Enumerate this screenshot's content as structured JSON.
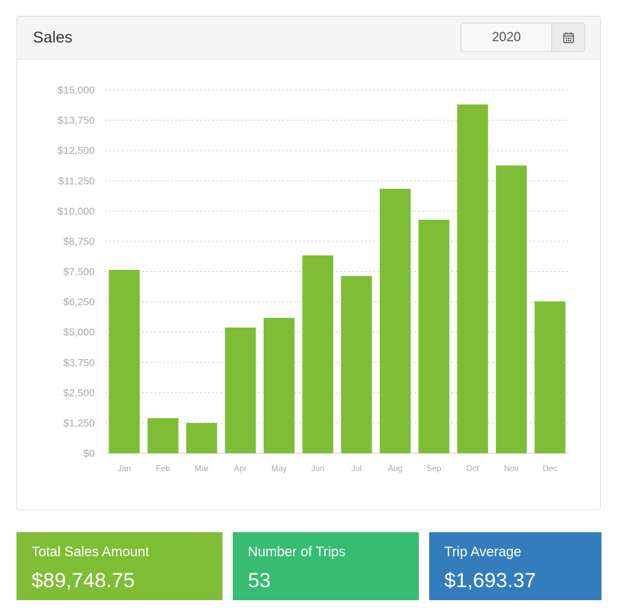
{
  "panel": {
    "title": "Sales",
    "year": "2020",
    "calendar_icon": "calendar-icon"
  },
  "chart_data": {
    "type": "bar",
    "title": "",
    "xlabel": "",
    "ylabel": "",
    "categories": [
      "Jan",
      "Feb",
      "Mar",
      "Apr",
      "May",
      "Jun",
      "Jul",
      "Aug",
      "Sep",
      "Oct",
      "Nov",
      "Dec"
    ],
    "values": [
      7570,
      1450,
      1250,
      5190,
      5590,
      8170,
      7320,
      10920,
      9640,
      14400,
      11880,
      6270
    ],
    "ylim": [
      0,
      15000
    ],
    "yticks": [
      "$0",
      "$1,250",
      "$2,500",
      "$3,750",
      "$5,000",
      "$6,250",
      "$7,500",
      "$8,750",
      "$10,000",
      "$11,250",
      "$12,500",
      "$13,750",
      "$15,000"
    ],
    "grid": true,
    "color": "#7fbd36"
  },
  "cards": [
    {
      "label": "Total Sales Amount",
      "value": "$89,748.75",
      "color": "#7fbd36"
    },
    {
      "label": "Number of Trips",
      "value": "53",
      "color": "#36bc73"
    },
    {
      "label": "Trip Average",
      "value": "$1,693.37",
      "color": "#337dbd"
    }
  ]
}
